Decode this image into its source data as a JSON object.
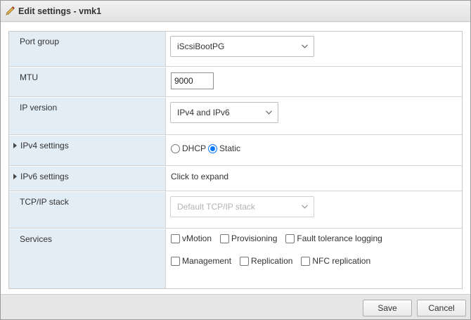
{
  "dialog": {
    "title": "Edit settings - vmk1",
    "icon": "pencil-icon"
  },
  "form": {
    "port_group": {
      "label": "Port group",
      "value": "iScsiBootPG"
    },
    "mtu": {
      "label": "MTU",
      "value": "9000"
    },
    "ip_version": {
      "label": "IP version",
      "value": "IPv4 and IPv6"
    },
    "ipv4_settings": {
      "label": "IPv4 settings",
      "options": [
        "DHCP",
        "Static"
      ],
      "selected": "Static"
    },
    "ipv6_settings": {
      "label": "IPv6 settings",
      "value": "Click to expand"
    },
    "tcpip_stack": {
      "label": "TCP/IP stack",
      "value": "Default TCP/IP stack",
      "disabled": true
    },
    "services": {
      "label": "Services",
      "items": [
        "vMotion",
        "Provisioning",
        "Fault tolerance logging",
        "Management",
        "Replication",
        "NFC replication"
      ]
    }
  },
  "footer": {
    "save_label": "Save",
    "cancel_label": "Cancel"
  },
  "colors": {
    "label_bg": "#e3edf5",
    "radio_accent": "#0075ff",
    "footer_bg": "#e6e6e6"
  }
}
